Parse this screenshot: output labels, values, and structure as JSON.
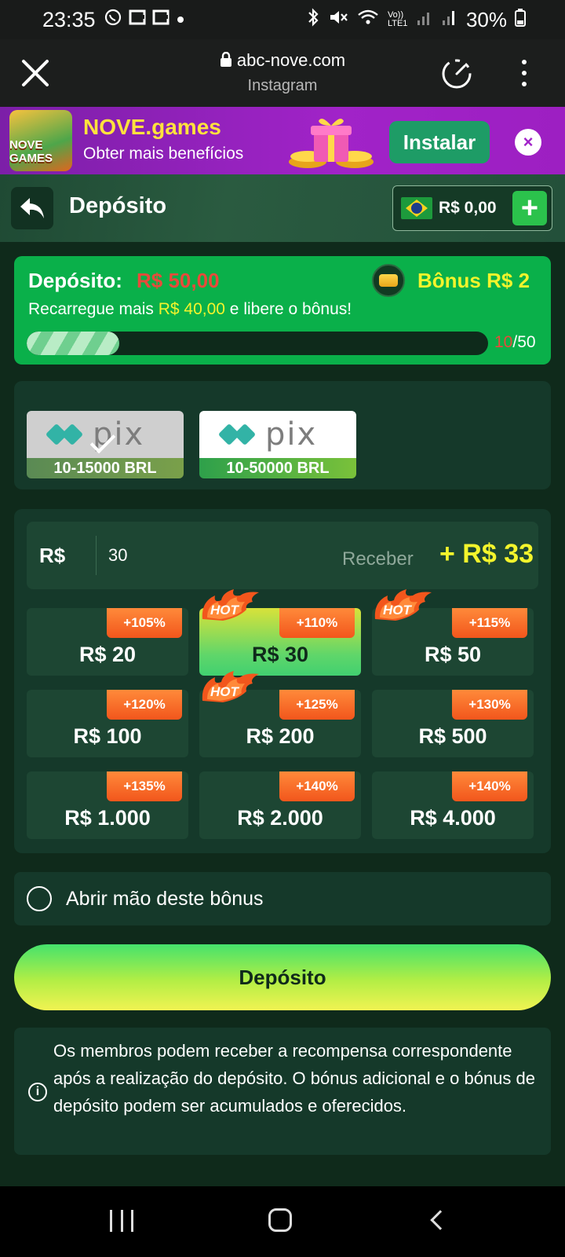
{
  "status_bar": {
    "time": "23:35",
    "battery": "30%",
    "left_icons": [
      "whatsapp-icon",
      "s-icon",
      "s-icon",
      "dot-icon"
    ],
    "right_icons": [
      "bluetooth-icon",
      "mute-icon",
      "wifi-icon",
      "lte-icon",
      "signal-icon",
      "signal-icon",
      "battery-icon"
    ],
    "lte_label": "Vo)) LTE1"
  },
  "browser": {
    "url": "abc-nove.com",
    "source": "Instagram"
  },
  "promo": {
    "logo_text": "NOVE GAMES",
    "title": "NOVE.games",
    "subtitle": "Obter mais benefícios",
    "install_label": "Instalar",
    "close_label": "×"
  },
  "header": {
    "title": "Depósito",
    "balance": "R$ 0,00",
    "plus_label": "+"
  },
  "bonus": {
    "label": "Depósito:",
    "amount": "R$ 50,00",
    "bonus_label": "Bônus R$ 2",
    "desc_prefix": "Recarregue mais ",
    "desc_amount": "R$ 40,00",
    "desc_suffix": " e libere o bônus!",
    "progress_current": "10",
    "progress_total": "/50",
    "progress_fraction": 0.2
  },
  "payment_methods": [
    {
      "name": "pix",
      "range": "10-15000 BRL",
      "selected": true
    },
    {
      "name": "pix",
      "range": "10-50000 BRL",
      "selected": false
    }
  ],
  "amount": {
    "currency": "R$",
    "value": "30",
    "receive_label": "Receber",
    "receive_value": "+ R$ 33"
  },
  "tiles": [
    {
      "amount": "R$ 20",
      "pct": "+105%",
      "hot": false,
      "active": false
    },
    {
      "amount": "R$ 30",
      "pct": "+110%",
      "hot": true,
      "active": true
    },
    {
      "amount": "R$ 50",
      "pct": "+115%",
      "hot": true,
      "active": false
    },
    {
      "amount": "R$ 100",
      "pct": "+120%",
      "hot": false,
      "active": false
    },
    {
      "amount": "R$ 200",
      "pct": "+125%",
      "hot": true,
      "active": false
    },
    {
      "amount": "R$ 500",
      "pct": "+130%",
      "hot": false,
      "active": false
    },
    {
      "amount": "R$ 1.000",
      "pct": "+135%",
      "hot": false,
      "active": false
    },
    {
      "amount": "R$ 2.000",
      "pct": "+140%",
      "hot": false,
      "active": false
    },
    {
      "amount": "R$ 4.000",
      "pct": "+140%",
      "hot": false,
      "active": false
    }
  ],
  "hot_label": "HOT",
  "option": {
    "label": "Abrir mão deste bônus"
  },
  "deposit_button": "Depósito",
  "info": {
    "icon_text": "i",
    "text": "Os membros podem receber a recompensa correspondente após a realização do depósito. O bónus adicional e o bónus de depósito podem ser acumulados e oferecidos."
  },
  "colors": {
    "accent_green": "#0ab04a",
    "yellow": "#f3f42c",
    "red": "#e84a3a",
    "card_bg": "#15392a"
  }
}
